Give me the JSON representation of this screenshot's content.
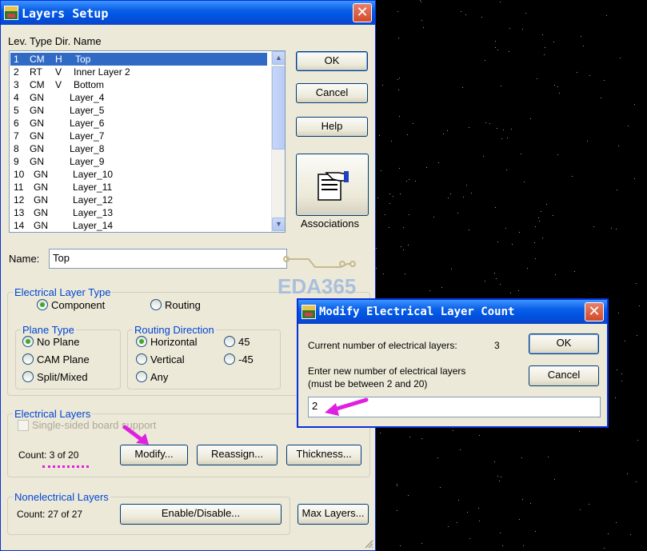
{
  "main_dialog": {
    "title": "Layers Setup",
    "close_glyph": "✕",
    "list_header": "Lev. Type Dir. Name",
    "layers": [
      {
        "lev": "1",
        "type": "CM",
        "dir": "H",
        "name": "Top",
        "selected": true
      },
      {
        "lev": "2",
        "type": "RT",
        "dir": "V",
        "name": "Inner Layer 2"
      },
      {
        "lev": "3",
        "type": "CM",
        "dir": "V",
        "name": "Bottom"
      },
      {
        "lev": "4",
        "type": "GN",
        "dir": "",
        "name": "Layer_4"
      },
      {
        "lev": "5",
        "type": "GN",
        "dir": "",
        "name": "Layer_5"
      },
      {
        "lev": "6",
        "type": "GN",
        "dir": "",
        "name": "Layer_6"
      },
      {
        "lev": "7",
        "type": "GN",
        "dir": "",
        "name": "Layer_7"
      },
      {
        "lev": "8",
        "type": "GN",
        "dir": "",
        "name": "Layer_8"
      },
      {
        "lev": "9",
        "type": "GN",
        "dir": "",
        "name": "Layer_9"
      },
      {
        "lev": "10",
        "type": "GN",
        "dir": "",
        "name": "Layer_10"
      },
      {
        "lev": "11",
        "type": "GN",
        "dir": "",
        "name": "Layer_11"
      },
      {
        "lev": "12",
        "type": "GN",
        "dir": "",
        "name": "Layer_12"
      },
      {
        "lev": "13",
        "type": "GN",
        "dir": "",
        "name": "Layer_13"
      },
      {
        "lev": "14",
        "type": "GN",
        "dir": "",
        "name": "Layer_14"
      }
    ],
    "buttons": {
      "ok": "OK",
      "cancel": "Cancel",
      "help": "Help",
      "associations": "Associations"
    },
    "name_label": "Name:",
    "name_value": "Top",
    "electrical_layer_type": {
      "title": "Electrical Layer Type",
      "component": "Component",
      "routing": "Routing"
    },
    "plane_type": {
      "title": "Plane Type",
      "no_plane": "No Plane",
      "cam_plane": "CAM Plane",
      "split_mixed": "Split/Mixed"
    },
    "routing_direction": {
      "title": "Routing Direction",
      "horizontal": "Horizontal",
      "vertical": "Vertical",
      "any": "Any",
      "deg45": "45",
      "deg_neg45": "-45"
    },
    "electrical_layers": {
      "title": "Electrical Layers",
      "single_sided": "Single-sided board support",
      "count": "Count:  3 of 20",
      "modify": "Modify...",
      "reassign": "Reassign...",
      "thickness": "Thickness..."
    },
    "nonelectrical_layers": {
      "title": "Nonelectrical Layers",
      "count": "Count: 27 of 27",
      "enable_disable": "Enable/Disable...",
      "max_layers": "Max Layers..."
    }
  },
  "watermark": "EDA365",
  "modify_dialog": {
    "title": "Modify Electrical Layer Count",
    "close_glyph": "✕",
    "current_label": "Current number of electrical layers:",
    "current_value": "3",
    "enter_label": "Enter new number of electrical layers",
    "range_label": "(must be between  2 and 20)",
    "input_value": "2",
    "ok": "OK",
    "cancel": "Cancel"
  },
  "colors": {
    "titlebar": "#0055e5",
    "group_title": "#0046d5",
    "selection": "#316ac5",
    "annotation": "#e020e0",
    "radio_dot": "#3eab28"
  }
}
